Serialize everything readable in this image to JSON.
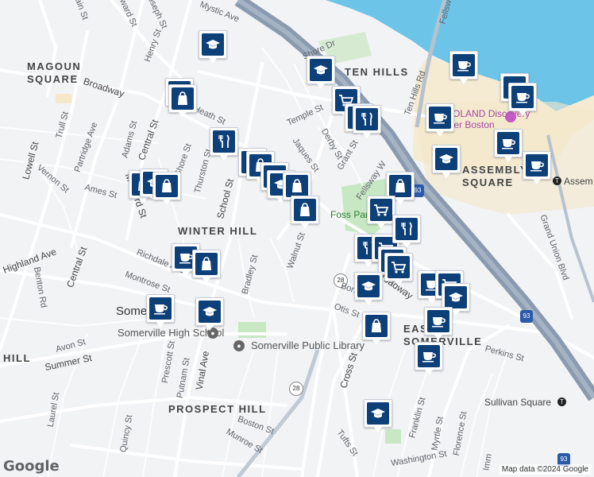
{
  "labels": {
    "neighborhoods": {
      "magoun_square": "MAGOUN\nSQUARE",
      "ten_hills": "TEN HILLS",
      "winter_hill": "WINTER HILL",
      "assembly_square": "ASSEMBLY\nSQUARE",
      "east_somerville": "EAST\nSOMERVILLE",
      "prospect_hill": "PROSPECT HILL",
      "hill": "HILL",
      "somerville": "Somerville"
    },
    "pois": {
      "legal_discovery": "LEGOLAND Discovery\nCenter Boston",
      "high_school": "Somerville High School",
      "library": "Somerville Public Library",
      "foss_park": "Foss Park",
      "sullivan_square": "Sullivan Square",
      "assembly_station": "Assem"
    },
    "streets": {
      "mystic_ave": "Mystic Ave",
      "broadway": "Broadway",
      "temple_st": "Temple St",
      "grant_st": "Grant St",
      "derby_st": "Derby St",
      "jaques_st": "Jaques St",
      "ten_hills_rd": "Ten Hills Rd",
      "fellsway_w": "Fellsway W",
      "walnut_st": "Walnut St",
      "school_st": "School St",
      "thurston_st": "Thurston St",
      "medford_st": "Medford St",
      "central_st": "Central St",
      "adams_st": "Adams St",
      "trull_st": "Trull St",
      "partridge_ave": "Partridge Ave",
      "lowell_st": "Lowell St",
      "vernon_st": "Vernon St",
      "ames_st": "Ames St",
      "richdale_ave": "Richdale Ave",
      "montrose_st": "Montrose St",
      "bradley_st": "Bradley St",
      "highland_ave": "Highland Ave",
      "benton_rd": "Benton Rd",
      "avon_st": "Avon St",
      "summer_st": "Summer St",
      "prescott_st": "Prescott St",
      "putnam_st": "Putnam St",
      "vinal_ave": "Vinal Ave",
      "laurel_st": "Laurel St",
      "quincy_st": "Quincy St",
      "boston_st": "Boston St",
      "munroe_st": "Munroe St",
      "cross_st": "Cross St",
      "otis_st": "Otis St",
      "perkins_st": "Perkins St",
      "franklin_st": "Franklin St",
      "myrtle_st": "Myrtle St",
      "florence_st": "Florence St",
      "tufts_st": "Tufts St",
      "grand_union_blvd": "Grand Union Blvd",
      "henry_st": "Henry St",
      "shore_dr": "Shore Dr",
      "heath_st": "Heath St",
      "joseph_st": "Joseph St",
      "pearl_st": "Pearl St",
      "bonair_st": "Bonair St",
      "washington_st": "Washington St",
      "fellsway": "Fellsway",
      "ward_st": "oward St",
      "wain_st": "ain St",
      "mo_st": "St",
      "shore_st": "Shore St",
      "e_st": "e",
      "ave": "Ave",
      "ave_2": "Ave",
      "st_b": "St",
      "vine": "vine",
      "en_st": "en St",
      "imm": "Imm",
      "hs": "H"
    },
    "routes": {
      "r28_a": "28",
      "r28_b": "28",
      "i93_a": "93",
      "i93_b": "93",
      "i93_c": "93"
    }
  },
  "markers": [
    {
      "icon": "school",
      "label": "school"
    },
    {
      "icon": "school",
      "label": "school"
    },
    {
      "icon": "shopping-bag",
      "label": "store"
    },
    {
      "icon": "shopping-bag",
      "label": "store"
    },
    {
      "icon": "shopping-cart",
      "label": "supermarket"
    },
    {
      "icon": "fork-knife",
      "label": "restaurant"
    },
    {
      "icon": "fork-knife",
      "label": "restaurant"
    },
    {
      "icon": "fork-knife",
      "label": "restaurant"
    },
    {
      "icon": "fork-knife",
      "label": "restaurant"
    },
    {
      "icon": "shopping-bag",
      "label": "store"
    },
    {
      "icon": "shopping-cart",
      "label": "supermarket"
    },
    {
      "icon": "school",
      "label": "school"
    },
    {
      "icon": "shopping-bag",
      "label": "store"
    },
    {
      "icon": "shopping-bag",
      "label": "store"
    },
    {
      "icon": "shopping-bag",
      "label": "store"
    },
    {
      "icon": "school",
      "label": "school"
    },
    {
      "icon": "shopping-bag",
      "label": "store"
    },
    {
      "icon": "shopping-bag",
      "label": "store"
    },
    {
      "icon": "shopping-cart",
      "label": "supermarket"
    },
    {
      "icon": "fork-knife",
      "label": "restaurant"
    },
    {
      "icon": "shopping-cart",
      "label": "supermarket"
    },
    {
      "icon": "fork-knife",
      "label": "restaurant"
    },
    {
      "icon": "fork-knife",
      "label": "restaurant"
    },
    {
      "icon": "shopping-cart",
      "label": "supermarket"
    },
    {
      "icon": "school",
      "label": "school"
    },
    {
      "icon": "school",
      "label": "school"
    },
    {
      "icon": "coffee-cup",
      "label": "cafe"
    },
    {
      "icon": "shopping-cart",
      "label": "supermarket"
    },
    {
      "icon": "school",
      "label": "school"
    },
    {
      "icon": "shopping-bag",
      "label": "store"
    },
    {
      "icon": "coffee-cup",
      "label": "cafe"
    },
    {
      "icon": "coffee-cup",
      "label": "cafe"
    },
    {
      "icon": "coffee-cup",
      "label": "cafe"
    },
    {
      "icon": "shopping-bag",
      "label": "store"
    },
    {
      "icon": "coffee-cup",
      "label": "cafe"
    },
    {
      "icon": "coffee-cup",
      "label": "cafe"
    },
    {
      "icon": "coffee-cup",
      "label": "cafe"
    },
    {
      "icon": "coffee-cup",
      "label": "cafe"
    },
    {
      "icon": "coffee-cup",
      "label": "cafe"
    },
    {
      "icon": "school",
      "label": "school"
    },
    {
      "icon": "coffee-cup",
      "label": "cafe"
    },
    {
      "icon": "coffee-cup",
      "label": "cafe"
    },
    {
      "icon": "school",
      "label": "school"
    }
  ],
  "footer": {
    "logo": "Google",
    "attribution": "Map data ©2024 Google"
  },
  "colors": {
    "water": "#6cc5e8",
    "park": "#c7e8c3",
    "highway": "#8a9bb0",
    "marker_fill": "#0d3f78",
    "commercial": "#f4e8c9"
  }
}
